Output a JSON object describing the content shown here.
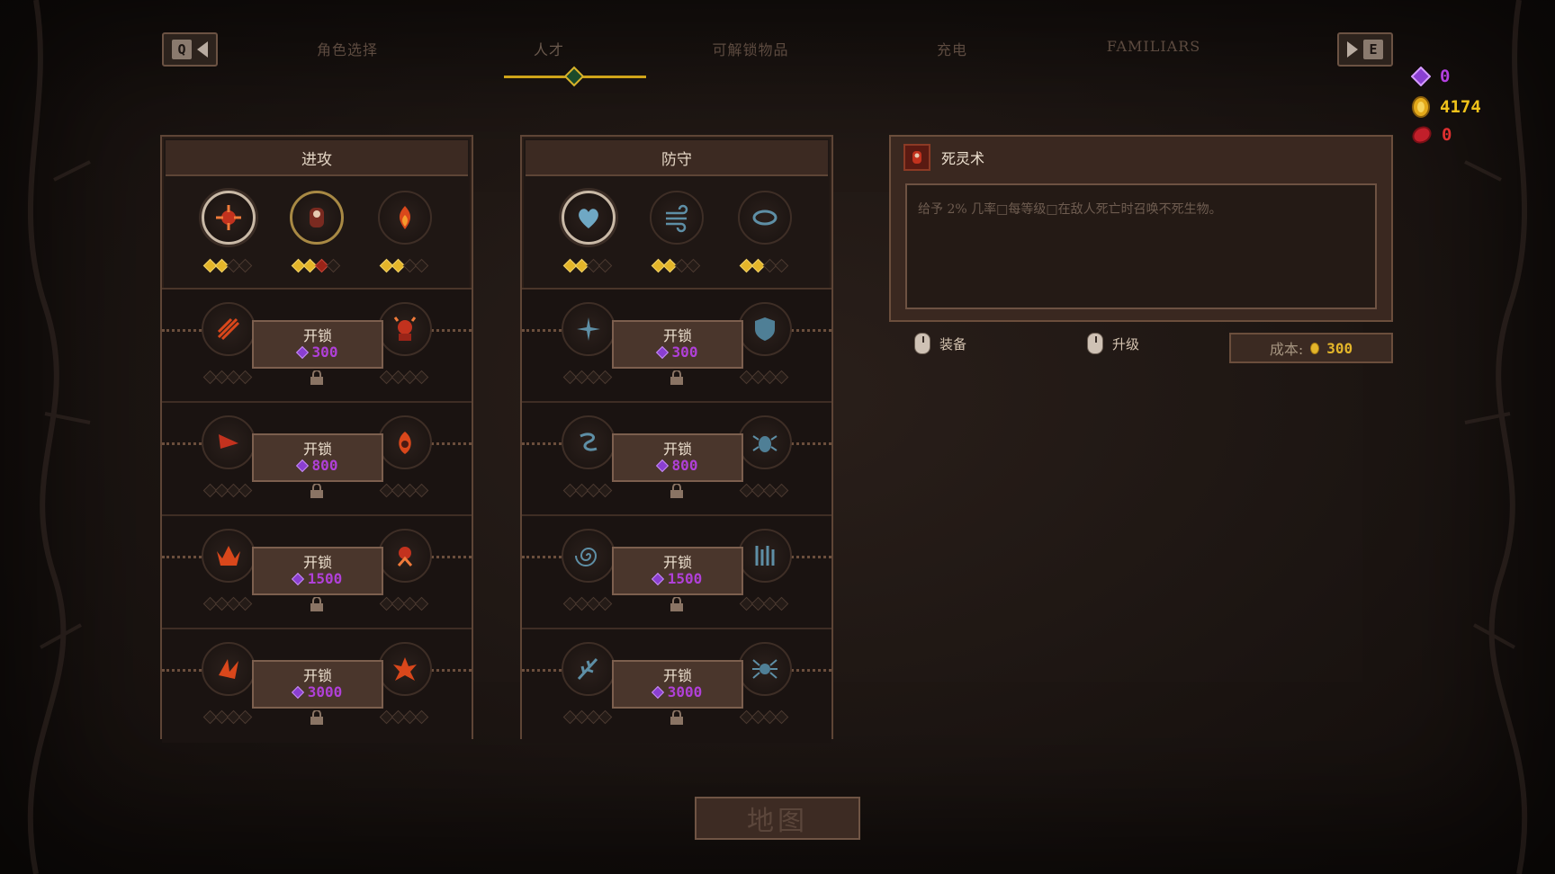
{
  "nav": {
    "prev_key": "Q",
    "next_key": "E",
    "tabs": [
      {
        "label": "角色选择",
        "active": false
      },
      {
        "label": "人才",
        "active": true
      },
      {
        "label": "可解锁物品",
        "active": false
      },
      {
        "label": "充电",
        "active": false
      },
      {
        "label": "FAMILIARS",
        "active": false
      }
    ]
  },
  "currencies": {
    "gems": "0",
    "gold": "4174",
    "blood": "0",
    "gem_color": "#b440e0",
    "gold_color": "#f0c21a",
    "blood_color": "#e03030"
  },
  "offense": {
    "title": "进攻",
    "base_icons": [
      "crosshair-burst-icon",
      "necromancer-icon",
      "fire-icon"
    ],
    "tiers": [
      {
        "unlock_label": "开锁",
        "cost": "300",
        "icons": [
          "claw-slash-icon",
          "demon-icon"
        ]
      },
      {
        "unlock_label": "开锁",
        "cost": "800",
        "icons": [
          "blade-icon",
          "flame-hood-icon"
        ]
      },
      {
        "unlock_label": "开锁",
        "cost": "1500",
        "icons": [
          "phoenix-icon",
          "imp-icon"
        ]
      },
      {
        "unlock_label": "开锁",
        "cost": "3000",
        "icons": [
          "burning-claw-icon",
          "fire-burst-icon"
        ]
      }
    ]
  },
  "defense": {
    "title": "防守",
    "base_icons": [
      "heart-shield-icon",
      "wind-icon",
      "ring-icon"
    ],
    "tiers": [
      {
        "unlock_label": "开锁",
        "cost": "300",
        "icons": [
          "sparkle-icon",
          "shield-icon"
        ]
      },
      {
        "unlock_label": "开锁",
        "cost": "800",
        "icons": [
          "serpent-icon",
          "beetle-icon"
        ]
      },
      {
        "unlock_label": "开锁",
        "cost": "1500",
        "icons": [
          "vortex-icon",
          "pillars-icon"
        ]
      },
      {
        "unlock_label": "开锁",
        "cost": "3000",
        "icons": [
          "feather-icon",
          "spider-icon"
        ]
      }
    ]
  },
  "detail": {
    "title": "死灵术",
    "description": "给予 2% 几率□每等级□在敌人死亡时召唤不死生物。",
    "equip_label": "装备",
    "upgrade_label": "升级",
    "cost_label": "成本:",
    "cost_value": "300"
  },
  "map_button": "地图"
}
